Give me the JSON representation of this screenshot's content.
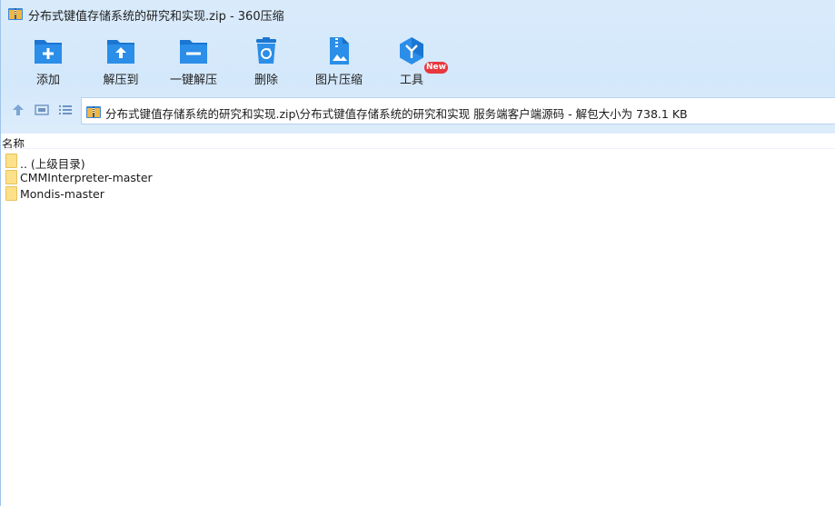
{
  "window": {
    "title": "分布式键值存储系统的研究和实现.zip - 360压缩"
  },
  "toolbar": {
    "items": [
      {
        "id": "add",
        "label": "添加",
        "icon": "folder-plus-icon"
      },
      {
        "id": "extract-to",
        "label": "解压到",
        "icon": "folder-upload-icon"
      },
      {
        "id": "one-click-extract",
        "label": "一键解压",
        "icon": "folder-minus-icon"
      },
      {
        "id": "delete",
        "label": "删除",
        "icon": "recycle-bin-icon"
      },
      {
        "id": "image-compress",
        "label": "图片压缩",
        "icon": "image-zip-icon"
      },
      {
        "id": "tools",
        "label": "工具",
        "icon": "hexagon-y-icon"
      }
    ],
    "new_badge": "New"
  },
  "address": {
    "path": "分布式键值存储系统的研究和实现.zip\\分布式键值存储系统的研究和实现 服务端客户端源码 - 解包大小为 738.1 KB"
  },
  "list": {
    "header_name": "名称",
    "rows": [
      {
        "name": ".. (上级目录)"
      },
      {
        "name": "CMMInterpreter-master"
      },
      {
        "name": "Mondis-master"
      }
    ]
  },
  "colors": {
    "accent": "#2b8ee8",
    "accent_dark": "#1a6fc2",
    "toolbar_bg": "#d6e9fb",
    "badge": "#e8383d",
    "folder": "#fde08a"
  }
}
